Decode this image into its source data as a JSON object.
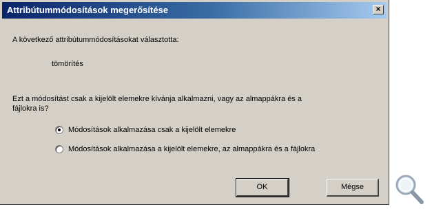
{
  "dialog": {
    "title": "Attribútummódosítások megerősítése",
    "close_label": "×",
    "intro": "A következő attribútummódosításokat választotta:",
    "change": "tömörítés",
    "question_line1": "Ezt a módosítást csak a kijelölt elemekre kívánja alkalmazni, vagy az almappákra és a",
    "question_line2": "fájlokra is?",
    "options": [
      {
        "label": "Módosítások alkalmazása csak a kijelölt elemekre",
        "checked": true
      },
      {
        "label": "Módosítások alkalmazása a kijelölt elemekre, az almappákra és a fájlokra",
        "checked": false
      }
    ],
    "ok_label": "OK",
    "cancel_label": "Mégse"
  },
  "icons": {
    "zoom": "magnifier-icon"
  }
}
